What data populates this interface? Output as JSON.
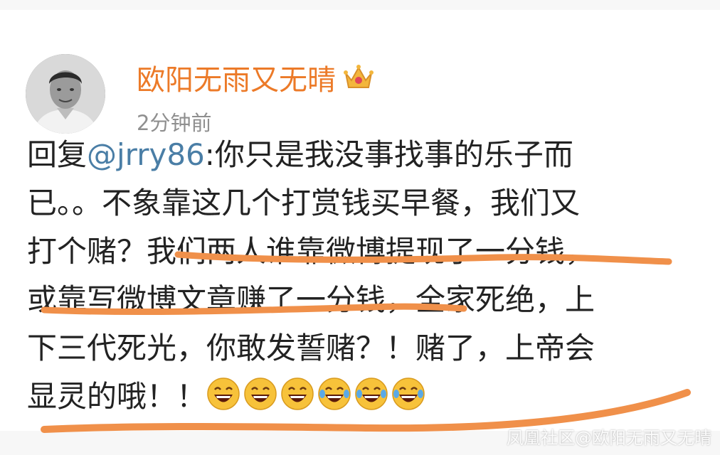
{
  "post": {
    "username": "欧阳无雨又无晴",
    "timestamp": "2分钟前",
    "lines": [
      {
        "prefix": "回复",
        "mention": "@jrry86",
        "rest": ":你只是我没事找事的乐子而"
      },
      {
        "text": "已。。不象靠这几个打赏钱买早餐，我们又"
      },
      {
        "text": "打个赌？我们两人谁靠微博提现了一分钱，"
      },
      {
        "text": "或靠写微博文章赚了一分钱，全家死绝，上"
      },
      {
        "text": "下三代死光，你敢发誓赌？！赌了，上帝会"
      },
      {
        "text": "显灵的哦！！"
      }
    ],
    "emoji_icons": [
      "laughing-face-icon",
      "laughing-face-icon",
      "laughing-face-icon",
      "tears-of-joy-icon",
      "tears-of-joy-icon",
      "tears-of-joy-icon"
    ]
  },
  "watermark": "凤凰社区@欧阳无雨又无晴",
  "colors": {
    "username": "#ec7a28",
    "mention": "#4a7ea6",
    "underline": "#f0904a"
  }
}
